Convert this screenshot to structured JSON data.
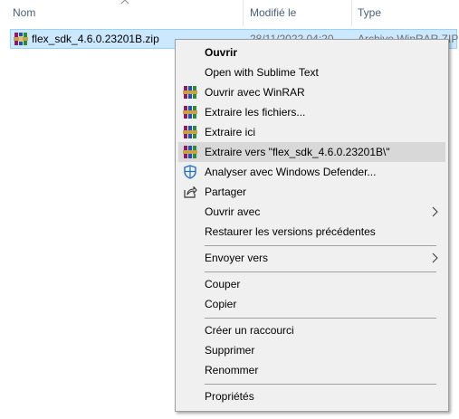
{
  "columns": {
    "name": "Nom",
    "modified": "Modifié le",
    "type": "Type"
  },
  "file": {
    "name": "flex_sdk_4.6.0.23201B.zip",
    "date": "28/11/2022 04:20",
    "type": "Archive WinRAR ZIP"
  },
  "menu": {
    "open": "Ouvrir",
    "open_sublime": "Open with Sublime Text",
    "open_winrar": "Ouvrir avec WinRAR",
    "extract_files": "Extraire les fichiers...",
    "extract_here": "Extraire ici",
    "extract_to": "Extraire vers \"flex_sdk_4.6.0.23201B\\\"",
    "scan_defender": "Analyser avec Windows Defender...",
    "share": "Partager",
    "open_with": "Ouvrir avec",
    "restore_versions": "Restaurer les versions précédentes",
    "send_to": "Envoyer vers",
    "cut": "Couper",
    "copy": "Copier",
    "create_shortcut": "Créer un raccourci",
    "delete": "Supprimer",
    "rename": "Renommer",
    "properties": "Propriétés"
  },
  "colors": {
    "selection_bg": "#cce8ff",
    "selection_border": "#99d1ff",
    "menu_bg": "#f0f0f0",
    "menu_hover": "#d8d8d8",
    "header_text": "#4c607a"
  }
}
